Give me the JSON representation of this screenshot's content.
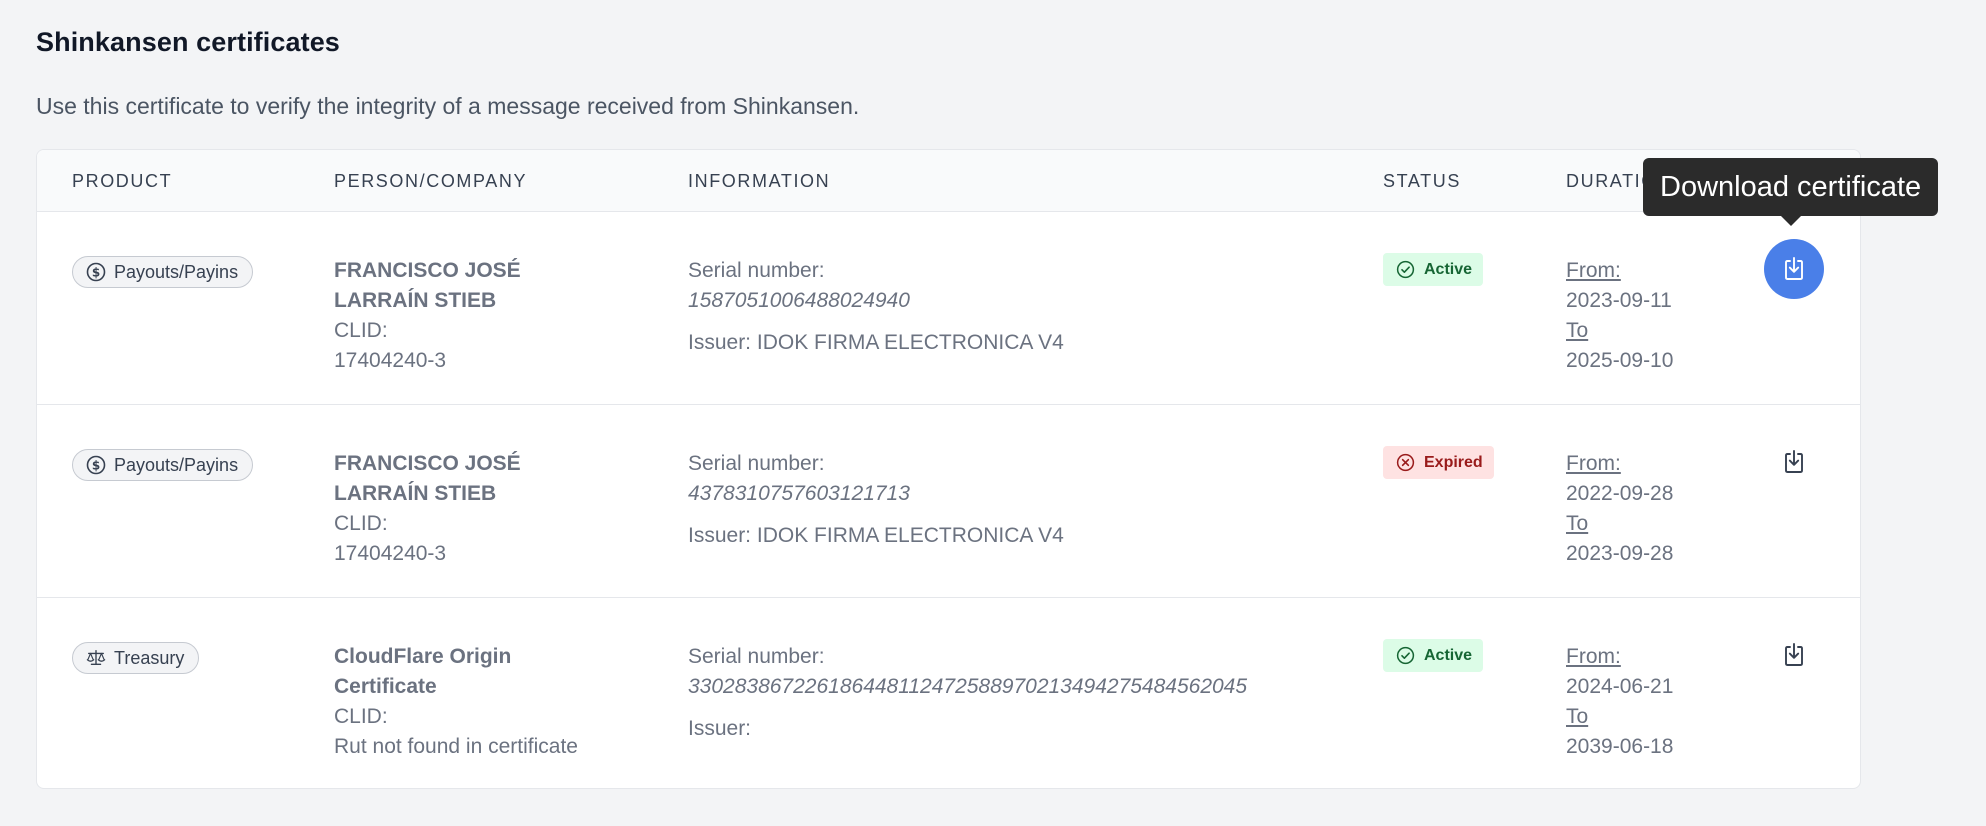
{
  "page": {
    "title": "Shinkansen certificates",
    "subtitle": "Use this certificate to verify the integrity of a message received from Shinkansen."
  },
  "table": {
    "headers": {
      "product": "PRODUCT",
      "person": "PERSON/COMPANY",
      "information": "INFORMATION",
      "status": "STATUS",
      "duration": "DURATIC"
    },
    "rows": [
      {
        "product": "Payouts/Payins",
        "product_icon": "dollar-circle-icon",
        "name_line1": "FRANCISCO JOSÉ",
        "name_line2": "LARRAÍN STIEB",
        "clid_label": "CLID:",
        "clid": "17404240-3",
        "serial_label": "Serial number:",
        "serial": "1587051006488024940",
        "issuer": "Issuer: IDOK FIRMA ELECTRONICA V4",
        "status": "Active",
        "status_icon": "check-circle-icon",
        "from_label": "From:",
        "from": "2023-09-11",
        "to_label": "To",
        "to": "2025-09-10"
      },
      {
        "product": "Payouts/Payins",
        "product_icon": "dollar-circle-icon",
        "name_line1": "FRANCISCO JOSÉ",
        "name_line2": "LARRAÍN STIEB",
        "clid_label": "CLID:",
        "clid": "17404240-3",
        "serial_label": "Serial number:",
        "serial": "4378310757603121713",
        "issuer": "Issuer: IDOK FIRMA ELECTRONICA V4",
        "status": "Expired",
        "status_icon": "x-circle-icon",
        "from_label": "From:",
        "from": "2022-09-28",
        "to_label": "To",
        "to": "2023-09-28"
      },
      {
        "product": "Treasury",
        "product_icon": "scales-icon",
        "name_line1": "CloudFlare Origin",
        "name_line2": "Certificate",
        "clid_label": "CLID:",
        "clid": "Rut not found in certificate",
        "serial_label": "Serial number:",
        "serial": "330283867226186448112472588970213494275484562045",
        "issuer": "Issuer:",
        "status": "Active",
        "status_icon": "check-circle-icon",
        "from_label": "From:",
        "from": "2024-06-21",
        "to_label": "To",
        "to": "2039-06-18"
      }
    ]
  },
  "tooltip": {
    "text": "Download certificate"
  },
  "colors": {
    "accent": "#4a7fe8",
    "active_bg": "#dcfce7",
    "active_text": "#166534",
    "expired_bg": "#fee2e2",
    "expired_text": "#991b1b"
  }
}
